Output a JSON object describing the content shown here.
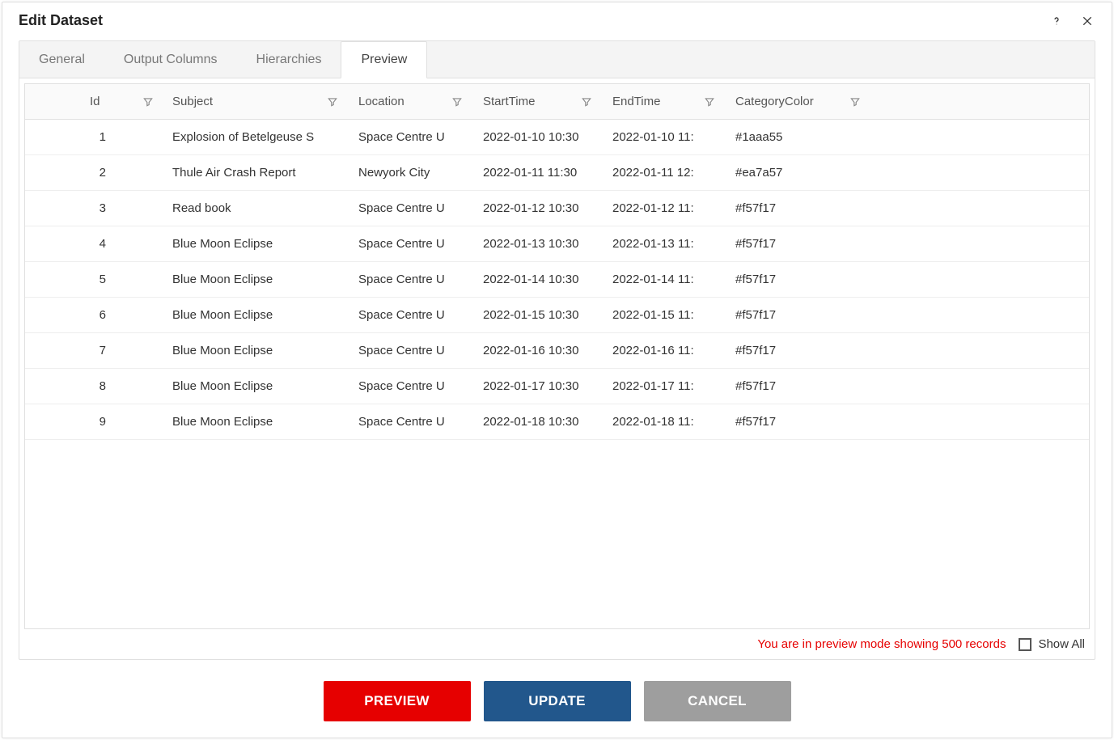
{
  "dialog": {
    "title": "Edit Dataset"
  },
  "tabs": [
    {
      "label": "General",
      "active": false
    },
    {
      "label": "Output Columns",
      "active": false
    },
    {
      "label": "Hierarchies",
      "active": false
    },
    {
      "label": "Preview",
      "active": true
    }
  ],
  "columns": {
    "id": "Id",
    "subject": "Subject",
    "location": "Location",
    "starttime": "StartTime",
    "endtime": "EndTime",
    "categorycolor": "CategoryColor"
  },
  "rows": [
    {
      "id": "1",
      "subject": "Explosion of Betelgeuse S",
      "location": "Space Centre U",
      "starttime": "2022-01-10 10:30",
      "endtime": "2022-01-10 11:",
      "categorycolor": "#1aaa55"
    },
    {
      "id": "2",
      "subject": "Thule Air Crash Report",
      "location": "Newyork City",
      "starttime": "2022-01-11 11:30",
      "endtime": "2022-01-11 12:",
      "categorycolor": "#ea7a57"
    },
    {
      "id": "3",
      "subject": "Read book",
      "location": "Space Centre U",
      "starttime": "2022-01-12 10:30",
      "endtime": "2022-01-12 11:",
      "categorycolor": "#f57f17"
    },
    {
      "id": "4",
      "subject": "Blue Moon Eclipse",
      "location": "Space Centre U",
      "starttime": "2022-01-13 10:30",
      "endtime": "2022-01-13 11:",
      "categorycolor": "#f57f17"
    },
    {
      "id": "5",
      "subject": "Blue Moon Eclipse",
      "location": "Space Centre U",
      "starttime": "2022-01-14 10:30",
      "endtime": "2022-01-14 11:",
      "categorycolor": "#f57f17"
    },
    {
      "id": "6",
      "subject": "Blue Moon Eclipse",
      "location": "Space Centre U",
      "starttime": "2022-01-15 10:30",
      "endtime": "2022-01-15 11:",
      "categorycolor": "#f57f17"
    },
    {
      "id": "7",
      "subject": "Blue Moon Eclipse",
      "location": "Space Centre U",
      "starttime": "2022-01-16 10:30",
      "endtime": "2022-01-16 11:",
      "categorycolor": "#f57f17"
    },
    {
      "id": "8",
      "subject": "Blue Moon Eclipse",
      "location": "Space Centre U",
      "starttime": "2022-01-17 10:30",
      "endtime": "2022-01-17 11:",
      "categorycolor": "#f57f17"
    },
    {
      "id": "9",
      "subject": "Blue Moon Eclipse",
      "location": "Space Centre U",
      "starttime": "2022-01-18 10:30",
      "endtime": "2022-01-18 11:",
      "categorycolor": "#f57f17"
    }
  ],
  "footer": {
    "preview_note": "You are in preview mode showing 500 records",
    "show_all_label": "Show All"
  },
  "buttons": {
    "preview": "PREVIEW",
    "update": "UPDATE",
    "cancel": "CANCEL"
  }
}
